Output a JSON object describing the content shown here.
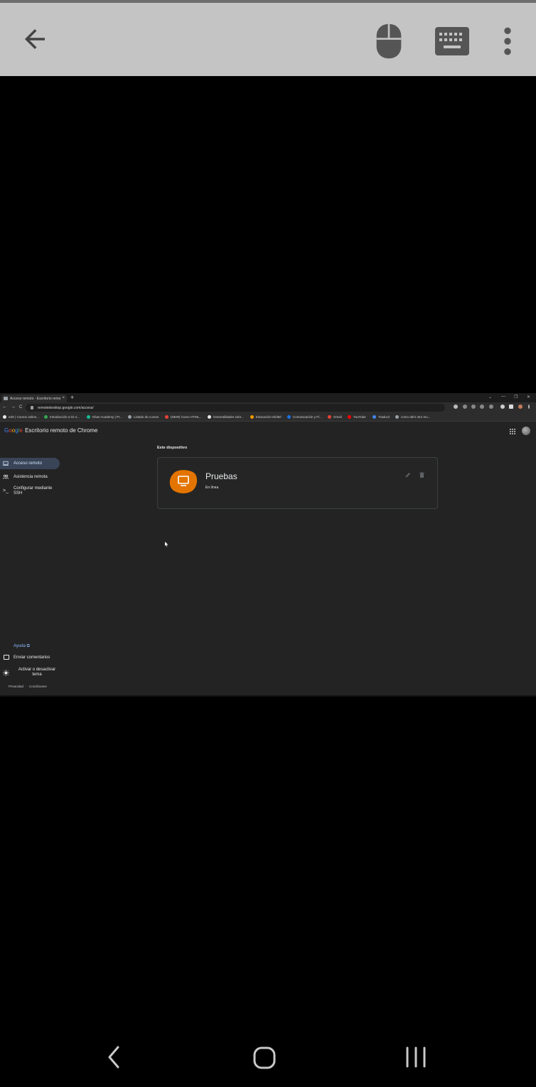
{
  "browser": {
    "tab_title": "Acceso remoto - Escritorio remo",
    "tab_close": "×",
    "new_tab": "+",
    "window_controls": [
      "⌄",
      "—",
      "❐",
      "✕"
    ],
    "nav": [
      "←",
      "→",
      "C"
    ],
    "url": "remotedesktop.google.com/access/",
    "bookmarks": [
      {
        "label": "edX | Cursos online...",
        "color": "#e8eaed"
      },
      {
        "label": "Introducción a Gi-4...",
        "color": "#34a853"
      },
      {
        "label": "Khan Academy | Pr...",
        "color": "#14bf96"
      },
      {
        "label": "Listado de cursos",
        "color": "#9aa0a6"
      },
      {
        "label": "(NEW) Curso HTML...",
        "color": "#ea4335"
      },
      {
        "label": "Generalidades sobr...",
        "color": "#e8eaed"
      },
      {
        "label": "Educación Infoltel",
        "color": "#f29900"
      },
      {
        "label": "Comunicación y Fl...",
        "color": "#1a73e8"
      },
      {
        "label": "Gmail",
        "color": "#ea4335"
      },
      {
        "label": "YouTube",
        "color": "#ff0000"
      },
      {
        "label": "Traducir",
        "color": "#4285f4"
      },
      {
        "label": "como abrir otro mo...",
        "color": "#9aa0a6"
      }
    ]
  },
  "app": {
    "logo_letters": [
      "G",
      "o",
      "o",
      "g",
      "l",
      "e"
    ],
    "product": "Escritorio remoto de Chrome"
  },
  "sidebar": {
    "items": [
      {
        "label": "Acceso remoto",
        "icon": "laptop-icon",
        "active": true
      },
      {
        "label": "Asistencia remota",
        "icon": "people-icon",
        "active": false
      }
    ],
    "ssh_label": "Configurar mediante SSH",
    "ssh_icon": ">_",
    "help": "Ayuda ⧉",
    "feedback": "Enviar comentarios",
    "theme": "Activar o desactivar tema",
    "footer": [
      "Privacidad",
      "·",
      "Condiciones"
    ]
  },
  "main": {
    "section_title": "Este dispositivo",
    "device": {
      "name": "Pruebas",
      "status": "En línea",
      "accent": "#e37400"
    }
  }
}
